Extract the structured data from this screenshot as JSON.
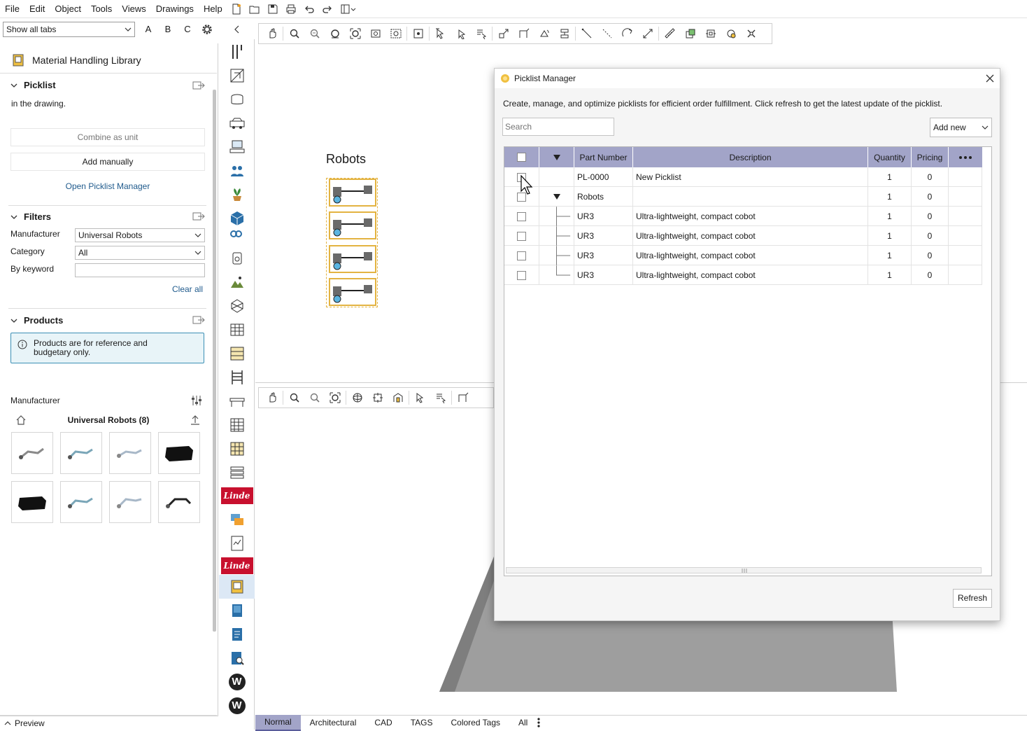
{
  "menu": [
    "File",
    "Edit",
    "Object",
    "Tools",
    "Views",
    "Drawings",
    "Help"
  ],
  "tab_filter": {
    "value": "Show all tabs",
    "letters": [
      "A",
      "B",
      "C"
    ]
  },
  "library": {
    "title": "Material Handling Library",
    "picklist": {
      "title": "Picklist",
      "truncated_text": "in the drawing.",
      "combine_label": "Combine as unit",
      "add_manually_label": "Add manually",
      "open_manager_label": "Open Picklist Manager"
    },
    "filters": {
      "title": "Filters",
      "manufacturer_label": "Manufacturer",
      "manufacturer_value": "Universal Robots",
      "category_label": "Category",
      "category_value": "All",
      "keyword_label": "By keyword",
      "keyword_value": "",
      "clear_all": "Clear all"
    },
    "products": {
      "title": "Products",
      "notice": "Products are for reference and budgetary only.",
      "manufacturer_label": "Manufacturer",
      "folder_title": "Universal Robots (8)"
    }
  },
  "preview_label": "Preview",
  "drawing": {
    "robots_label": "Robots"
  },
  "picklist_manager": {
    "title": "Picklist Manager",
    "description": "Create, manage, and optimize picklists for efficient order fulfillment. Click refresh to get the latest update of the picklist.",
    "search_placeholder": "Search",
    "add_new_label": "Add new",
    "columns": {
      "part_number": "Part Number",
      "description": "Description",
      "quantity": "Quantity",
      "pricing": "Pricing"
    },
    "rows": [
      {
        "part": "PL-0000",
        "desc": "New Picklist",
        "qty": "1",
        "price": "0"
      },
      {
        "part": "Robots",
        "desc": "",
        "qty": "1",
        "price": "0"
      },
      {
        "part": "UR3",
        "desc": "Ultra-lightweight, compact cobot",
        "qty": "1",
        "price": "0"
      },
      {
        "part": "UR3",
        "desc": "Ultra-lightweight, compact cobot",
        "qty": "1",
        "price": "0"
      },
      {
        "part": "UR3",
        "desc": "Ultra-lightweight, compact cobot",
        "qty": "1",
        "price": "0"
      },
      {
        "part": "UR3",
        "desc": "Ultra-lightweight, compact cobot",
        "qty": "1",
        "price": "0"
      }
    ],
    "refresh_label": "Refresh"
  },
  "bottom_tabs": [
    "Normal",
    "Architectural",
    "CAD",
    "TAGS",
    "Colored Tags",
    "All"
  ],
  "colors": {
    "header": "#a2a4c8",
    "accent_link": "#1f5a8c",
    "linde_red": "#c8102e",
    "robot_box": "#e3b341"
  }
}
